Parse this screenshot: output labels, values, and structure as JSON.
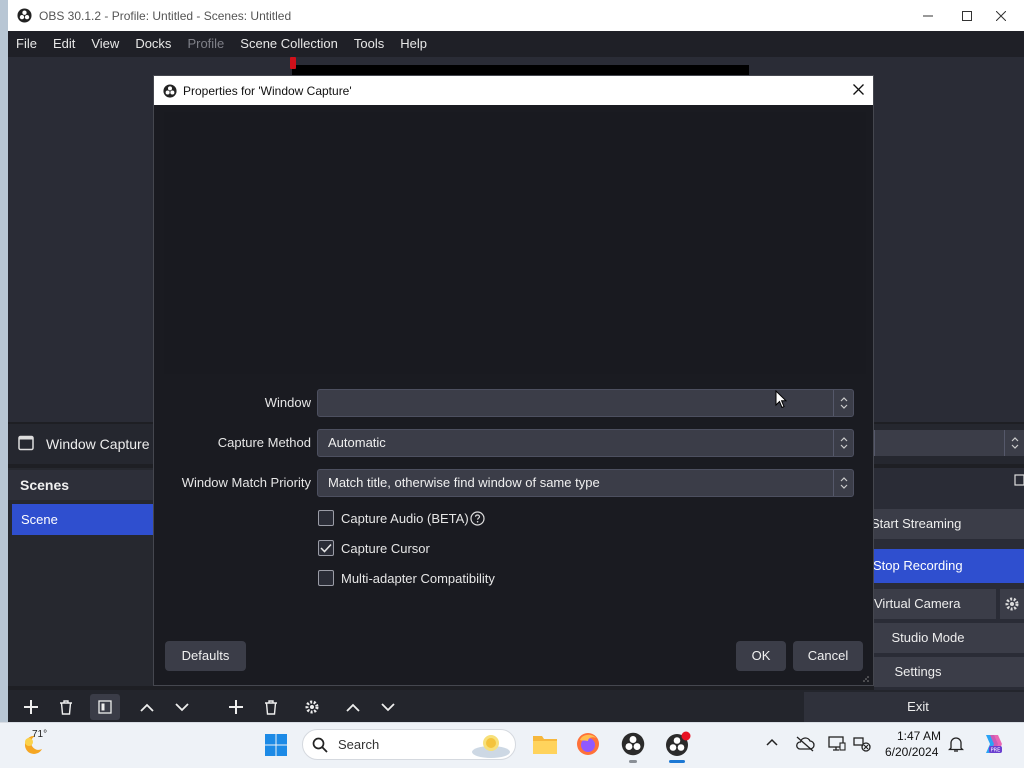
{
  "window": {
    "title": "OBS 30.1.2 - Profile: Untitled - Scenes: Untitled"
  },
  "menu": [
    "File",
    "Edit",
    "View",
    "Docks",
    "Profile",
    "Scene Collection",
    "Tools",
    "Help"
  ],
  "menu_disabled": [
    "Profile"
  ],
  "sources": {
    "selected": "Window Capture"
  },
  "scenes": {
    "header": "Scenes",
    "items": [
      "Scene"
    ]
  },
  "controls": {
    "start_streaming": "Start Streaming",
    "stop_recording": "Stop Recording",
    "virtual_camera": "Virtual Camera",
    "studio_mode": "Studio Mode",
    "settings": "Settings",
    "exit": "Exit"
  },
  "dialog": {
    "title": "Properties for 'Window Capture'",
    "window_label": "Window",
    "window_value": "",
    "capture_method_label": "Capture Method",
    "capture_method_value": "Automatic",
    "match_priority_label": "Window Match Priority",
    "match_priority_value": "Match title, otherwise find window of same type",
    "checkboxes": [
      {
        "label": "Capture Audio (BETA)",
        "checked": false
      },
      {
        "label": "Capture Cursor",
        "checked": true
      },
      {
        "label": "Multi-adapter Compatibility",
        "checked": false
      }
    ],
    "defaults_button": "Defaults",
    "ok_button": "OK",
    "cancel_button": "Cancel"
  },
  "taskbar": {
    "weather_temp": "71°",
    "search_placeholder": "Search",
    "time": "1:47 AM",
    "date": "6/20/2024"
  },
  "colors": {
    "accent": "#2f4fcf",
    "panel": "#2a2c36",
    "dialog_bg": "#1a1b21",
    "recording_red": "#d0101a"
  }
}
